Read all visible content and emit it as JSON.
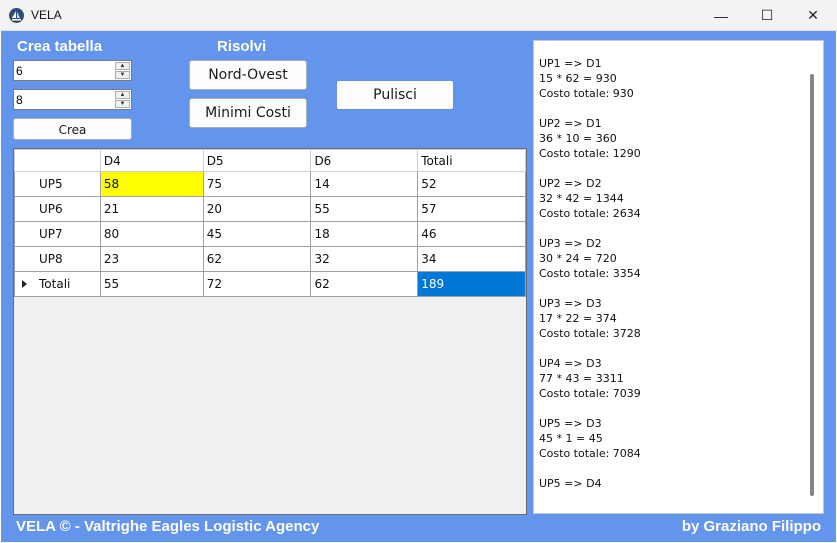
{
  "window": {
    "title": "VELA",
    "minimize": "—",
    "maximize": "☐",
    "close": "✕"
  },
  "crea": {
    "heading": "Crea tabella",
    "rows_value": "6",
    "cols_value": "8",
    "create_label": "Crea",
    "spin_up": "▲",
    "spin_down": "▼"
  },
  "risolvi": {
    "heading": "Risolvi",
    "nord_ovest_label": "Nord-Ovest",
    "minimi_costi_label": "Minimi Costi"
  },
  "pulisci_label": "Pulisci",
  "grid": {
    "columns": [
      "",
      "D4",
      "D5",
      "D6",
      "Totali"
    ],
    "rows": [
      {
        "label": "UP5",
        "cells": [
          "58",
          "75",
          "14",
          "52"
        ]
      },
      {
        "label": "UP6",
        "cells": [
          "21",
          "20",
          "55",
          "57"
        ]
      },
      {
        "label": "UP7",
        "cells": [
          "80",
          "45",
          "18",
          "46"
        ]
      },
      {
        "label": "UP8",
        "cells": [
          "23",
          "62",
          "32",
          "34"
        ]
      },
      {
        "label": "Totali",
        "cells": [
          "55",
          "72",
          "62",
          "189"
        ]
      }
    ],
    "highlight_color": "#ffff00",
    "selection_color": "#0078d7"
  },
  "log": {
    "lines": [
      "UP1 => D1",
      "15 * 62 = 930",
      "Costo totale: 930",
      "",
      "UP2 => D1",
      "36 * 10 = 360",
      "Costo totale: 1290",
      "",
      "UP2 => D2",
      "32 * 42 = 1344",
      "Costo totale: 2634",
      "",
      "UP3 => D2",
      "30 * 24 = 720",
      "Costo totale: 3354",
      "",
      "UP3 => D3",
      "17 * 22 = 374",
      "Costo totale: 3728",
      "",
      "UP4 => D3",
      "77 * 43 = 3311",
      "Costo totale: 7039",
      "",
      "UP5 => D3",
      "45 * 1 = 45",
      "Costo totale: 7084",
      "",
      "UP5 => D4"
    ]
  },
  "footer": {
    "left": "VELA © - Valtrighe Eagles Logistic Agency",
    "right": "by Graziano Filippo"
  },
  "colors": {
    "background": "#6495ed",
    "accent": "#0078d7"
  }
}
